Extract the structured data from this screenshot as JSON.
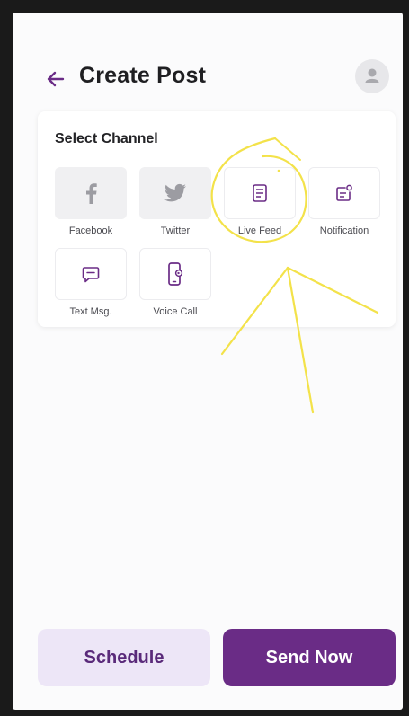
{
  "header": {
    "title": "Create Post",
    "back_icon": "arrow-left-icon",
    "avatar_icon": "user-icon"
  },
  "card": {
    "title": "Select Channel",
    "channels": [
      {
        "label": "Facebook",
        "icon": "facebook-icon",
        "style": "gray"
      },
      {
        "label": "Twitter",
        "icon": "twitter-icon",
        "style": "gray"
      },
      {
        "label": "Live Feed",
        "icon": "feed-icon",
        "style": "white"
      },
      {
        "label": "Notification",
        "icon": "notification-icon",
        "style": "white"
      },
      {
        "label": "Text Msg.",
        "icon": "message-icon",
        "style": "white"
      },
      {
        "label": "Voice Call",
        "icon": "phone-call-icon",
        "style": "white"
      }
    ]
  },
  "footer": {
    "schedule_label": "Schedule",
    "send_label": "Send Now"
  },
  "colors": {
    "accent": "#6a2c86",
    "accent_light": "#ede6f7",
    "annotation": "#f3e24a"
  }
}
